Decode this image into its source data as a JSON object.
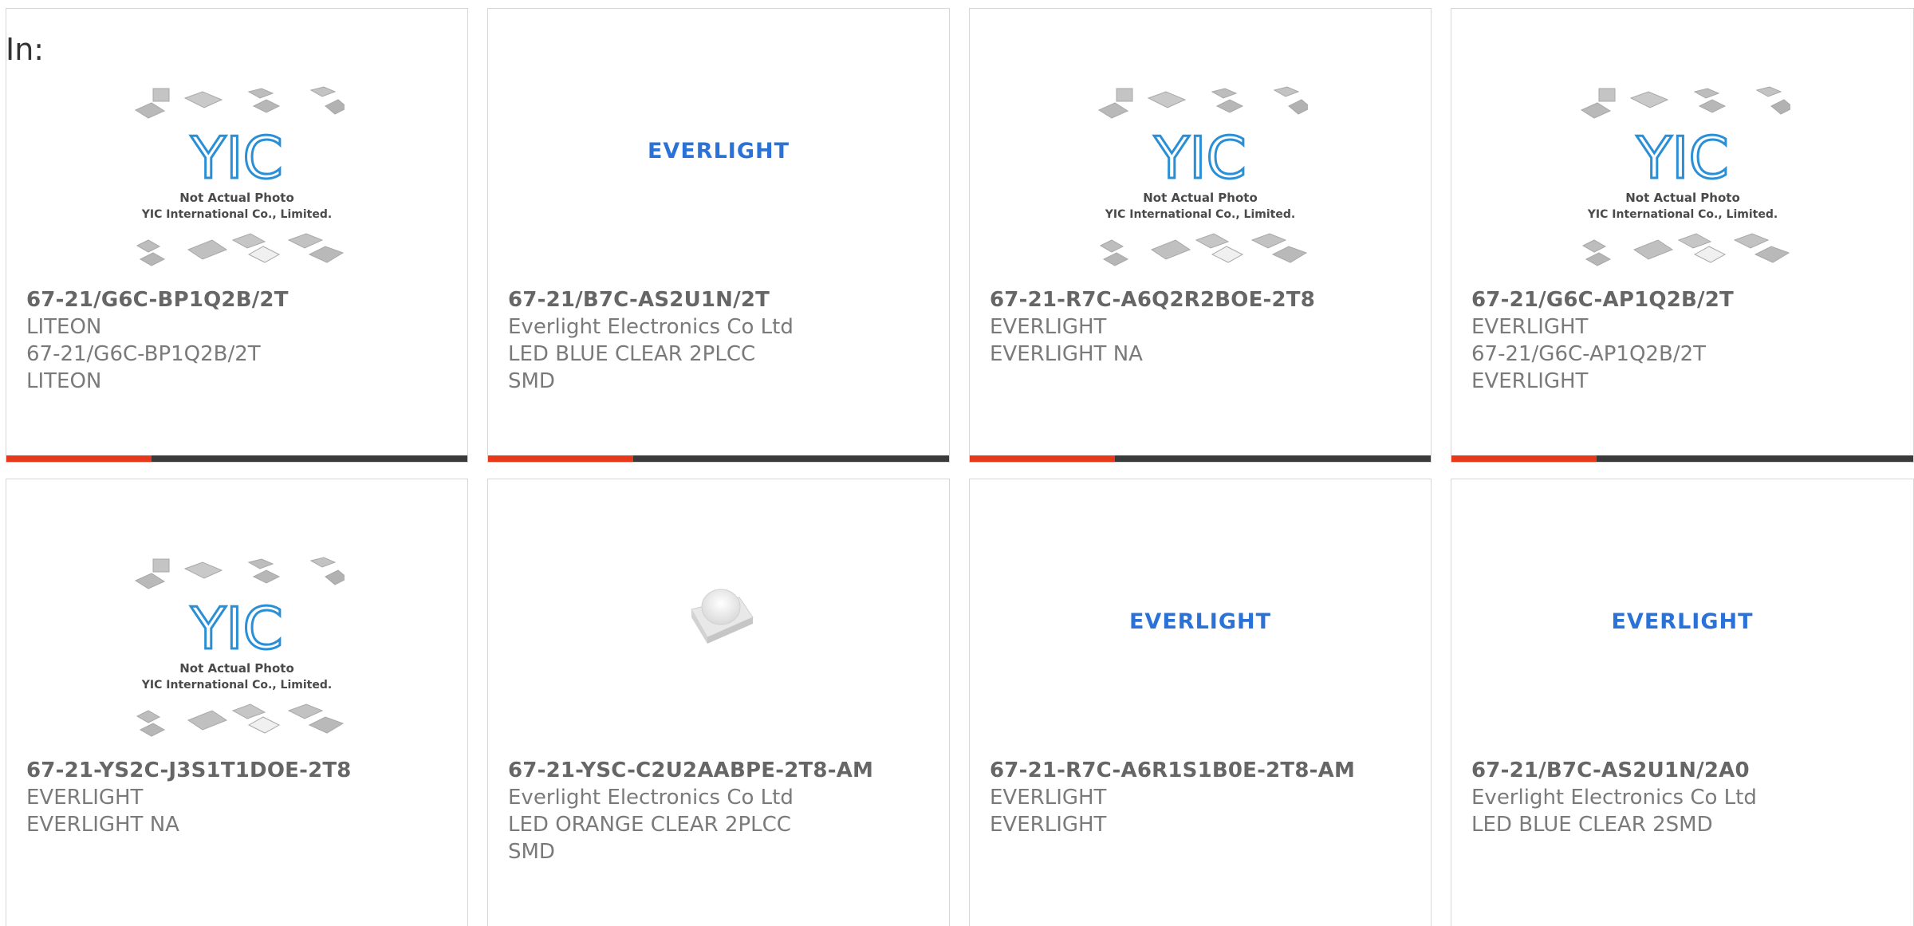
{
  "filter_label": "In:",
  "brand_colors": {
    "accent": "#e8381b",
    "bar": "#3a3a3a",
    "everlight_blue": "#2a72d8",
    "yic_blue": "#2b8fd6"
  },
  "placeholder_photo": {
    "line1": "Not Actual Photo",
    "line2": "YIC International Co., Limited.",
    "logo_text": "YIC"
  },
  "everlight_logo_text": "EVERLIGHT",
  "products": [
    {
      "part_number": "67-21/G6C-BP1Q2B/2T",
      "manufacturer": "LITEON",
      "description": "67-21/G6C-BP1Q2B/2T LITEON",
      "image": "yic-placeholder-icon"
    },
    {
      "part_number": "67-21/B7C-AS2U1N/2T",
      "manufacturer": "Everlight Electronics Co Ltd",
      "description": "LED BLUE CLEAR 2PLCC SMD",
      "image": "everlight-logo-icon"
    },
    {
      "part_number": "67-21-R7C-A6Q2R2BOE-2T8",
      "manufacturer": "EVERLIGHT",
      "description": "EVERLIGHT NA",
      "image": "yic-placeholder-icon"
    },
    {
      "part_number": "67-21/G6C-AP1Q2B/2T",
      "manufacturer": "EVERLIGHT",
      "description": "67-21/G6C-AP1Q2B/2T EVERLIGHT",
      "image": "yic-placeholder-icon"
    },
    {
      "part_number": "67-21-YS2C-J3S1T1DOE-2T8",
      "manufacturer": "EVERLIGHT",
      "description": "EVERLIGHT NA",
      "image": "yic-placeholder-icon"
    },
    {
      "part_number": "67-21-YSC-C2U2AABPE-2T8-AM",
      "manufacturer": "Everlight Electronics Co Ltd",
      "description": "LED ORANGE CLEAR 2PLCC SMD",
      "image": "led-photo-icon"
    },
    {
      "part_number": "67-21-R7C-A6R1S1B0E-2T8-AM",
      "manufacturer": "EVERLIGHT",
      "description": "EVERLIGHT",
      "image": "everlight-logo-icon"
    },
    {
      "part_number": "67-21/B7C-AS2U1N/2A0",
      "manufacturer": "Everlight Electronics Co Ltd",
      "description": "LED BLUE CLEAR 2SMD",
      "image": "everlight-logo-icon"
    }
  ]
}
